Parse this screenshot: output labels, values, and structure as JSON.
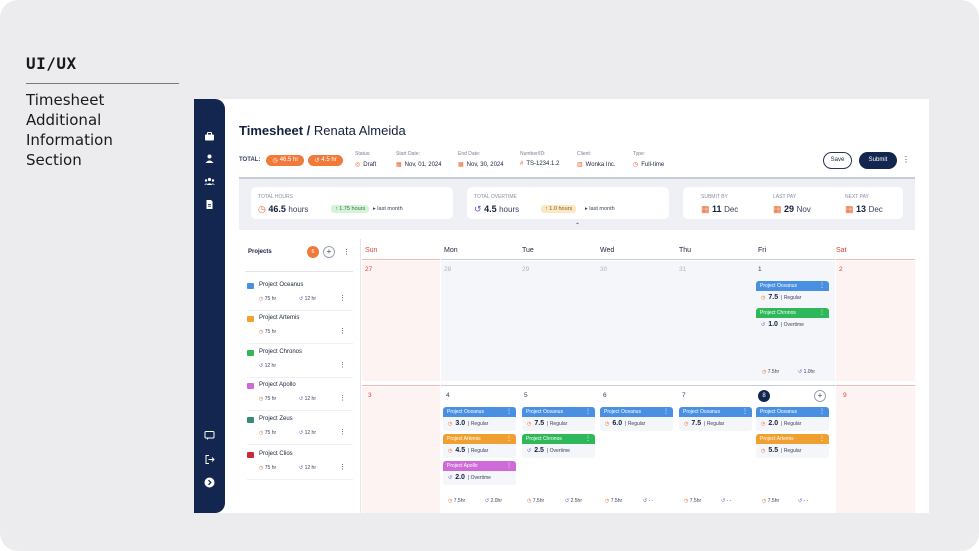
{
  "caption": {
    "tag": "UI/UX",
    "lines": [
      "Timesheet",
      "Additional Information",
      "Section"
    ]
  },
  "rail_icons": [
    "briefcase-icon",
    "user-icon",
    "team-icon",
    "document-icon",
    "chat-icon",
    "logout-icon",
    "arrow-right-icon"
  ],
  "header": {
    "title_bold": "Timesheet /",
    "title_name": "Renata Almeida",
    "total_label": "TOTAL:",
    "total_hours": "46.5 hr",
    "total_overtime": "4.5 hr",
    "status_label": "Status:",
    "status_value": "Draft",
    "start_label": "Start Date:",
    "start_value": "Nov, 01, 2024",
    "end_label": "End Date:",
    "end_value": "Nov, 30, 2024",
    "number_label": "Number/ID:",
    "number_value": "TS-1234.1.2",
    "client_label": "Client:",
    "client_value": "Wonka Inc.",
    "type_label": "Type:",
    "type_value": "Full-time",
    "save_label": "Save",
    "submit_label": "Submit"
  },
  "summary": {
    "total_hours_label": "TOTAL HOURS",
    "total_hours_value": "46.5",
    "total_hours_unit": "hours",
    "total_hours_delta": "↑ 1.75 hours",
    "total_hours_vs": "last month",
    "overtime_label": "TOTAL OVERTIME",
    "overtime_value": "4.5",
    "overtime_unit": "hours",
    "overtime_delta": "↑ 1.0 hours",
    "overtime_vs": "last month",
    "submit_by_label": "SUBMIT BY",
    "submit_by_day": "11",
    "submit_by_month": "Dec",
    "last_pay_label": "LAST PAY",
    "last_pay_day": "29",
    "last_pay_month": "Nov",
    "next_pay_label": "NEXT PAY",
    "next_pay_day": "13",
    "next_pay_month": "Dec"
  },
  "projects": {
    "header": "Projects",
    "count": "6",
    "items": [
      {
        "name": "Project Oceanus",
        "color": "#4a90e2",
        "hours": "75 hr",
        "overtime": "12 hr"
      },
      {
        "name": "Project Artemis",
        "color": "#f0a030",
        "hours": "75 hr",
        "overtime": ""
      },
      {
        "name": "Project Chronos",
        "color": "#2fb85a",
        "hours": "",
        "overtime": "12 hr"
      },
      {
        "name": "Project Apollo",
        "color": "#cf6ad9",
        "hours": "75 hr",
        "overtime": "12 hr"
      },
      {
        "name": "Project Zeus",
        "color": "#3a8a7a",
        "hours": "75 hr",
        "overtime": "12 hr"
      },
      {
        "name": "Project Clios",
        "color": "#d0283a",
        "hours": "75 hr",
        "overtime": "12 hr"
      }
    ]
  },
  "calendar": {
    "days": [
      "Sun",
      "Mon",
      "Tue",
      "Wed",
      "Thu",
      "Fri",
      "Sat"
    ],
    "week1_dates": [
      "27",
      "28",
      "29",
      "30",
      "31",
      "1",
      "2"
    ],
    "week2_dates": [
      "3",
      "4",
      "5",
      "6",
      "7",
      "8",
      "9"
    ],
    "fri1_entries": [
      {
        "project": "Project Oceanus",
        "value": "7.5",
        "kind": "Regular"
      },
      {
        "project": "Project Chronos",
        "value": "1.0",
        "kind": "Overtime"
      }
    ],
    "fri1_footer": {
      "regular": "7.5hr",
      "overtime": "1.0hr"
    },
    "mon_entries": [
      {
        "project": "Project Oceanus",
        "value": "3.0",
        "kind": "Regular"
      },
      {
        "project": "Project Artemis",
        "value": "4.5",
        "kind": "Regular"
      },
      {
        "project": "Project Apollo",
        "value": "2.0",
        "kind": "Overtime"
      }
    ],
    "mon_footer": {
      "regular": "7.5hr",
      "overtime": "2.0hr"
    },
    "tue_entries": [
      {
        "project": "Project Oceanus",
        "value": "7.5",
        "kind": "Regular"
      },
      {
        "project": "Project Chronos",
        "value": "2.5",
        "kind": "Overtime"
      }
    ],
    "tue_footer": {
      "regular": "7.5hr",
      "overtime": "2.5hr"
    },
    "wed_entries": [
      {
        "project": "Project Oceanus",
        "value": "6.0",
        "kind": "Regular"
      }
    ],
    "wed_footer": {
      "regular": "7.5hr",
      "overtime": "- -"
    },
    "thu_entries": [
      {
        "project": "Project Oceanus",
        "value": "7.5",
        "kind": "Regular"
      }
    ],
    "thu_footer": {
      "regular": "7.5hr",
      "overtime": "- -"
    },
    "fri2_entries": [
      {
        "project": "Project Oceanus",
        "value": "2.0",
        "kind": "Regular"
      },
      {
        "project": "Project Artemis",
        "value": "5.5",
        "kind": "Regular"
      }
    ],
    "fri2_footer": {
      "regular": "7.5hr",
      "overtime": "- -"
    }
  },
  "colors": {
    "navy": "#13264f",
    "orange": "#f07a3a",
    "oceanus": "#4a90e2",
    "artemis": "#f0a030",
    "chronos": "#2fb85a",
    "apollo": "#cf6ad9",
    "weekend_red": "#d9453a"
  }
}
